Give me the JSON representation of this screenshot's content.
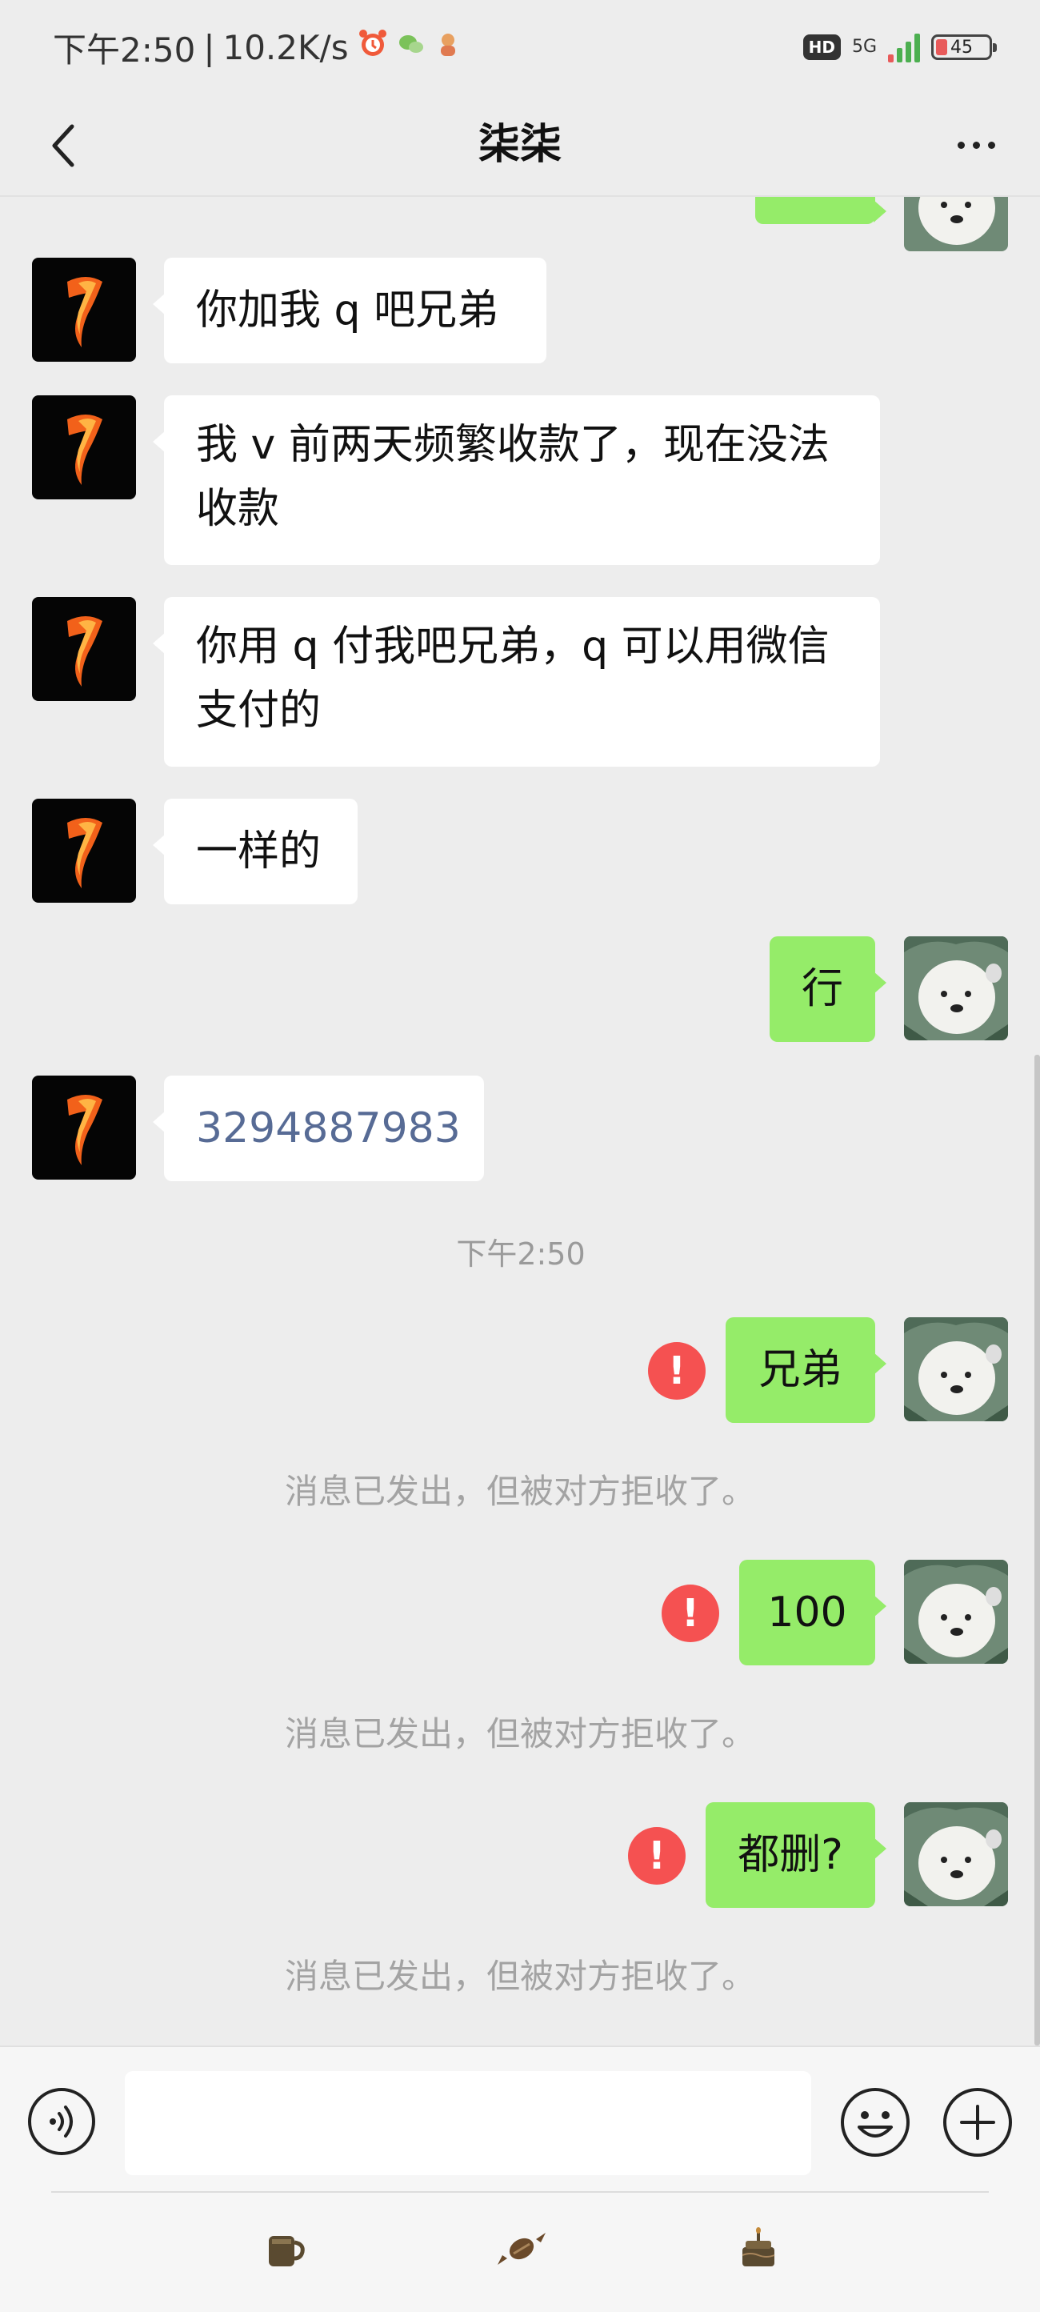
{
  "status_bar": {
    "time": "下午2:50",
    "speed": "10.2K/s",
    "hd": "HD",
    "network": "5G",
    "battery": "45"
  },
  "nav": {
    "title": "柒柒"
  },
  "messages": [
    {
      "side": "in",
      "text": "你加我 q 吧兄弟"
    },
    {
      "side": "in",
      "text": "我 v 前两天频繁收款了，现在没法收款"
    },
    {
      "side": "in",
      "text": "你用 q 付我吧兄弟，q 可以用微信支付的"
    },
    {
      "side": "in",
      "text": "一样的"
    },
    {
      "side": "out",
      "text": "行"
    },
    {
      "side": "in",
      "text": "3294887983"
    },
    {
      "side": "out",
      "text": "兄弟",
      "failed": true
    },
    {
      "side": "out",
      "text": "100",
      "failed": true
    },
    {
      "side": "out",
      "text": "都删?",
      "failed": true
    }
  ],
  "time_label": "下午2:50",
  "system_notice": "消息已发出，但被对方拒收了。",
  "error_mark": "!",
  "input": {
    "value": "",
    "placeholder": ""
  },
  "gifts": [
    "coffee-icon",
    "candy-icon",
    "cake-icon"
  ],
  "colors": {
    "bubble_out": "#95ec69",
    "bubble_in": "#ffffff",
    "error": "#f55151",
    "link": "#576b95",
    "background": "#ededed"
  }
}
